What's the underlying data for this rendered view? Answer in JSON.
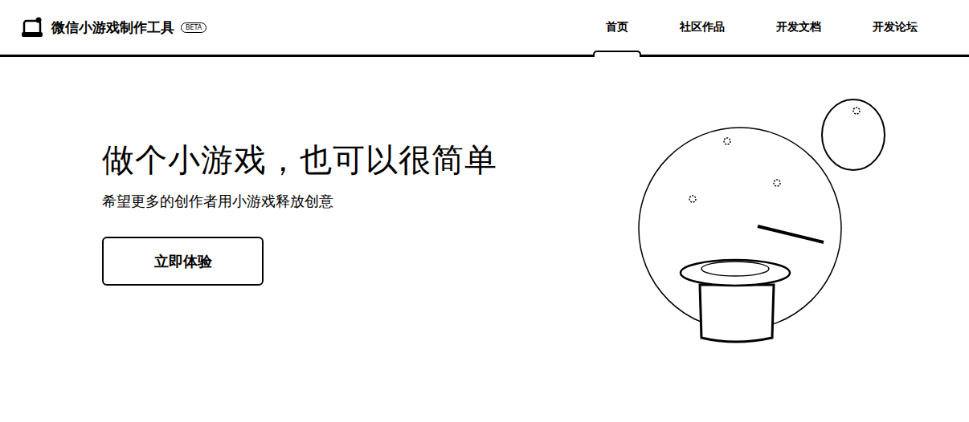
{
  "header": {
    "title": "微信小游戏制作工具",
    "badge": "BETA"
  },
  "nav": [
    {
      "label": "首页",
      "selected": true
    },
    {
      "label": "社区作品",
      "selected": false
    },
    {
      "label": "开发文档",
      "selected": false
    },
    {
      "label": "开发论坛",
      "selected": false
    }
  ],
  "hero": {
    "title": "做个小游戏，也可以很简单",
    "subtitle": "希望更多的创作者用小游戏释放创意",
    "button": "立即体验"
  }
}
